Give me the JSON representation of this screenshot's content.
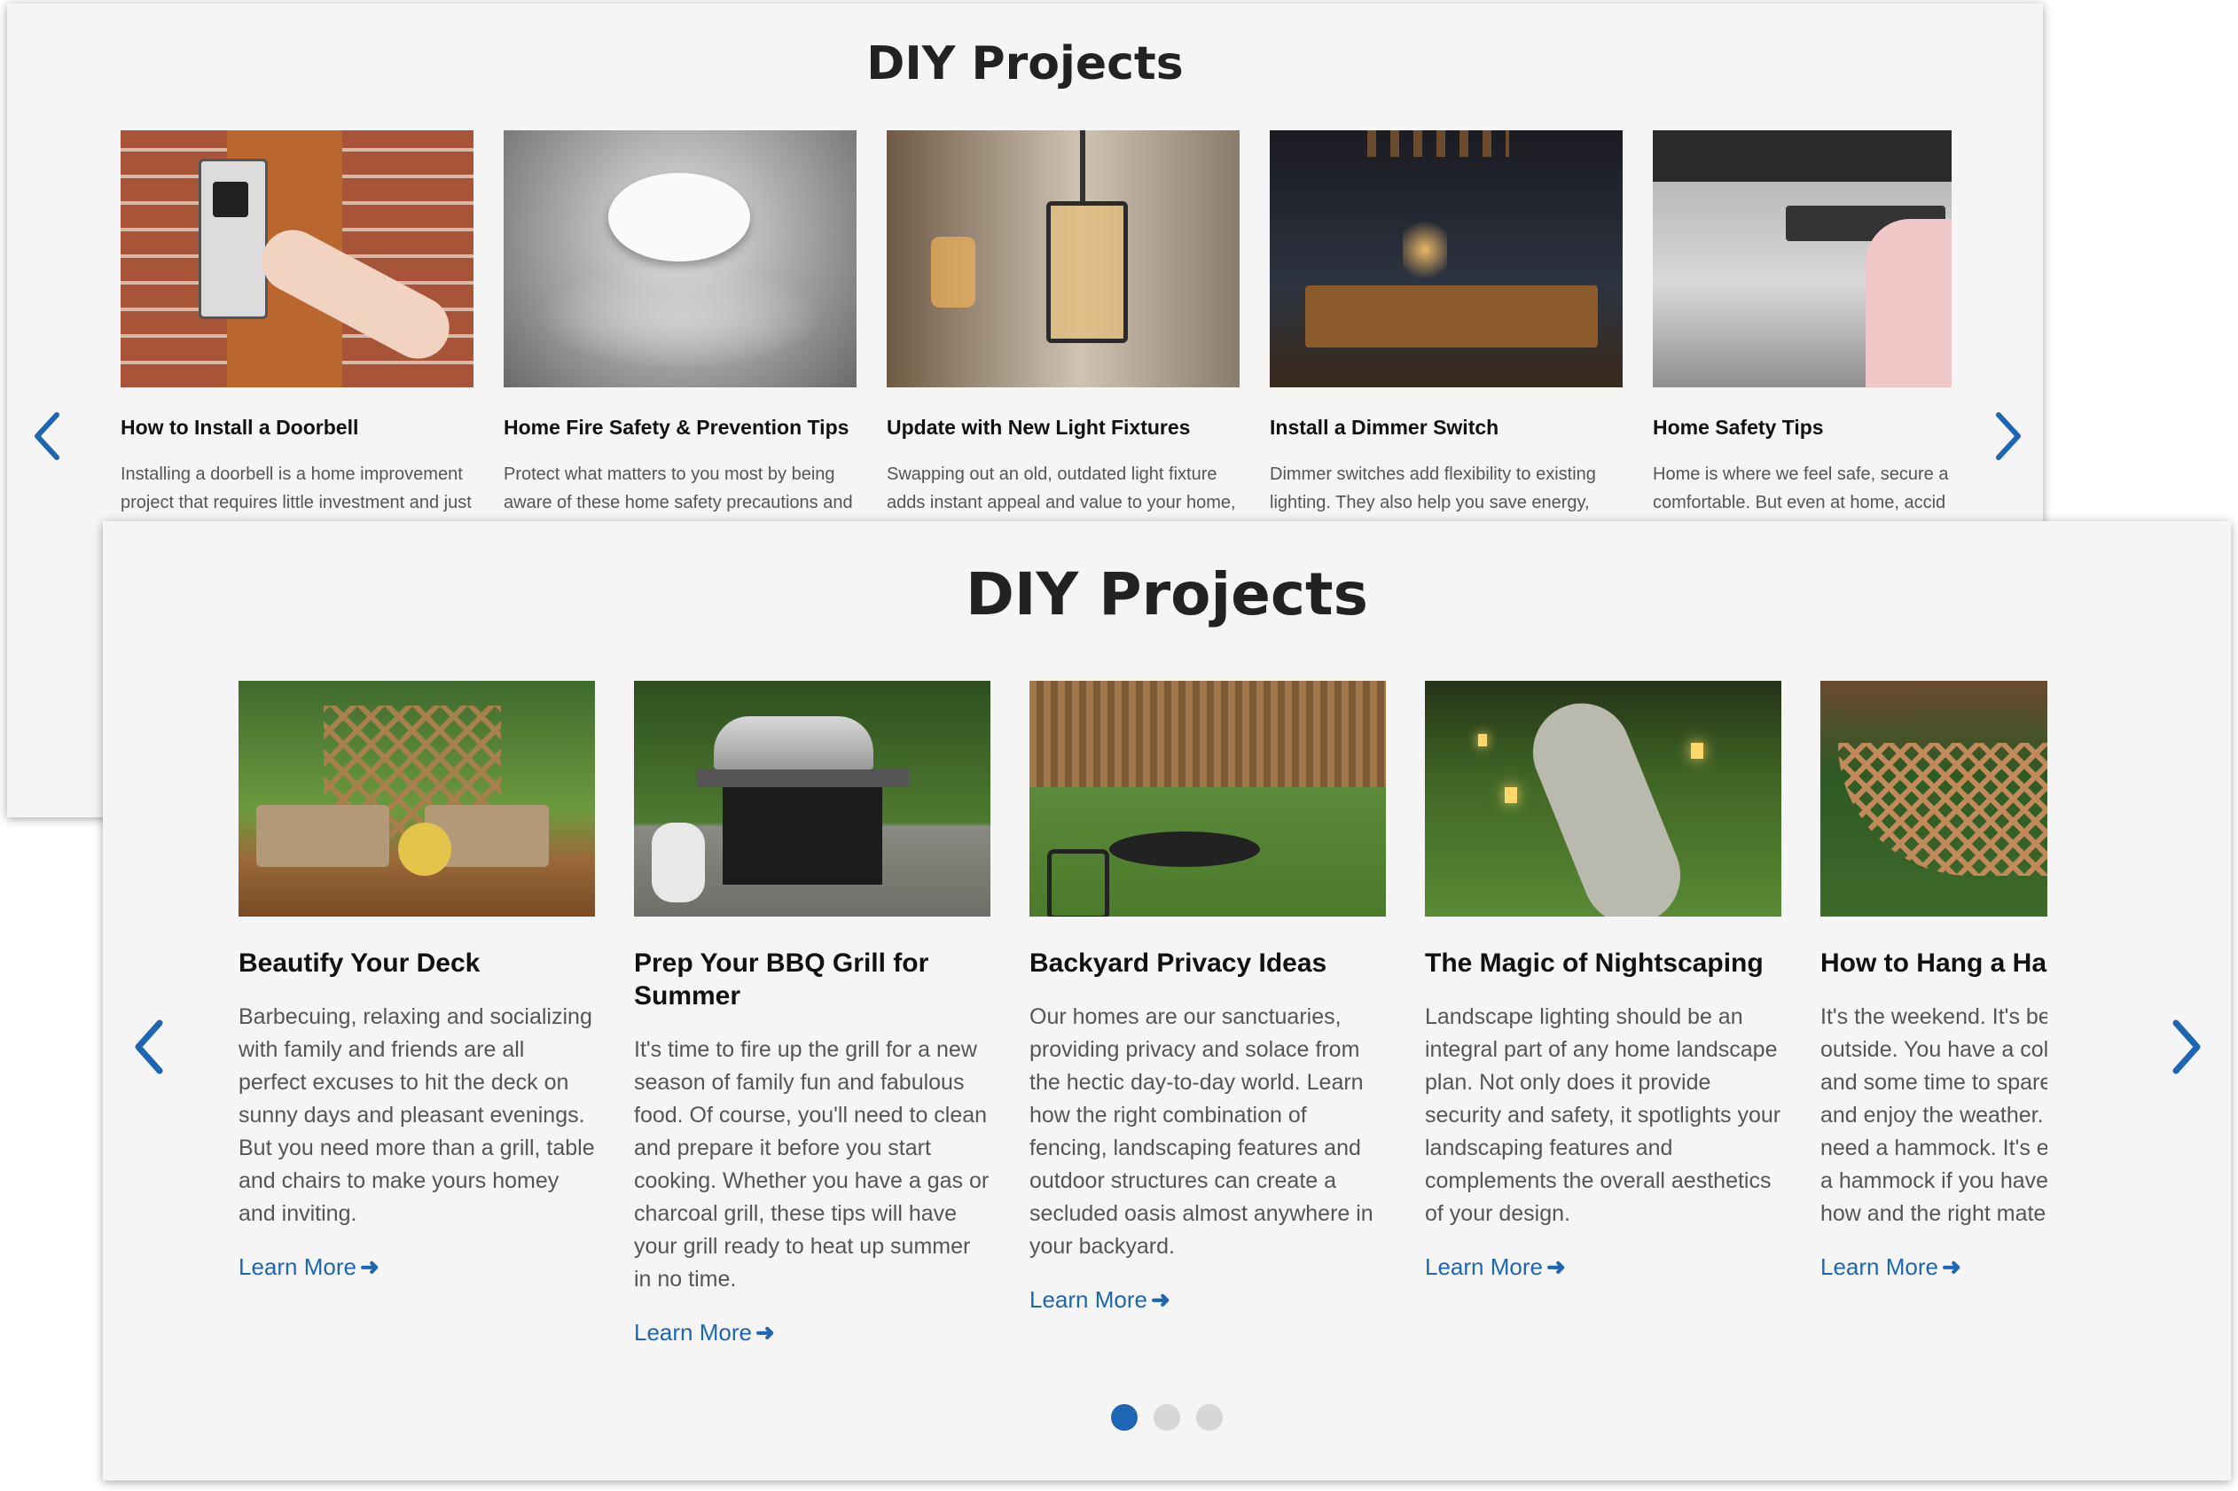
{
  "back_panel": {
    "title": "DIY Projects",
    "cards": [
      {
        "title": "How to Install a Doorbell",
        "desc_line1": "Installing a doorbell is a home improvement",
        "desc_line2": "project that requires little investment and just",
        "image_icon": "doorbell-photo"
      },
      {
        "title": "Home Fire Safety & Prevention Tips",
        "desc_line1": "Protect what matters to you most by being",
        "desc_line2": "aware of these home safety precautions and",
        "image_icon": "smoke-detector-photo"
      },
      {
        "title": "Update with New Light Fixtures",
        "desc_line1": "Swapping out an old, outdated light fixture",
        "desc_line2": "adds instant appeal and value to your home,",
        "image_icon": "pendant-light-photo"
      },
      {
        "title": "Install a Dimmer Switch",
        "desc_line1": "Dimmer switches add flexibility to existing",
        "desc_line2": "lighting. They also help you save energy,",
        "image_icon": "dining-room-photo"
      },
      {
        "title": "Home Safety Tips",
        "desc_line1": "Home is where we feel safe, secure a",
        "desc_line2": "comfortable. But even at home, accid",
        "image_icon": "oven-child-photo"
      }
    ]
  },
  "front_panel": {
    "title": "DIY Projects",
    "learn_more_label": "Learn More",
    "cards": [
      {
        "title": "Beautify Your Deck",
        "desc": "Barbecuing, relaxing and socializing with family and friends are all perfect excuses to hit the deck on sunny days and pleasant evenings. But you need more than a grill, table and chairs to make yours homey and inviting.",
        "image_icon": "deck-furniture-photo"
      },
      {
        "title": "Prep Your BBQ Grill for Summer",
        "desc": "It's time to fire up the grill for a new season of family fun and fabulous food. Of course, you'll need to clean and prepare it before you start cooking. Whether you have a gas or charcoal grill, these tips will have your grill ready to heat up summer in no time.",
        "image_icon": "bbq-grill-photo"
      },
      {
        "title": "Backyard Privacy Ideas",
        "desc": "Our homes are our sanctuaries, providing privacy and solace from the hectic day-to-day world. Learn how the right combination of fencing, landscaping features and outdoor structures can create a secluded oasis almost anywhere in your backyard.",
        "image_icon": "backyard-patio-photo"
      },
      {
        "title": "The Magic of Nightscaping",
        "desc": "Landscape lighting should be an integral part of any home landscape plan. Not only does it provide security and safety, it spotlights your landscaping features and complements the overall aesthetics of your design.",
        "image_icon": "lit-pathway-photo"
      },
      {
        "title": "How to Hang a Hammock",
        "desc": "It's the weekend. It's beautiful outside. You have a cold beverage and some time to spare to lie back and enjoy the weather. Now you just need a hammock. It's easy to hang a hammock if you have the know-how and the right materials.",
        "image_icon": "hammock-photo"
      }
    ],
    "pagination": {
      "total": 3,
      "active": 1
    }
  },
  "colors": {
    "accent": "#1e66b4",
    "panel_bg": "#f5f5f5",
    "dot_inactive": "#d6d6d6"
  }
}
